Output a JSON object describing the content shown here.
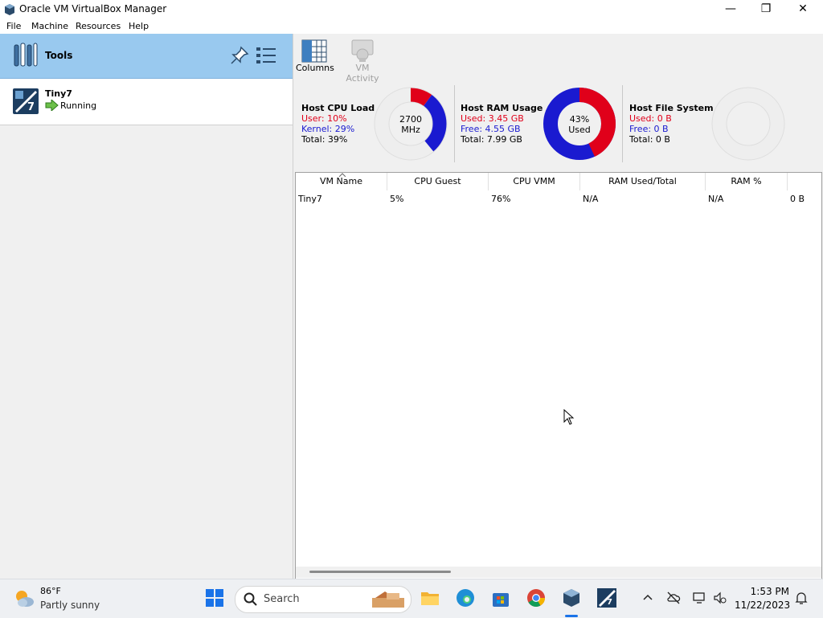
{
  "window": {
    "title": "Oracle VM VirtualBox Manager",
    "controls": {
      "minimize": "—",
      "maximize": "❐",
      "close": "✕"
    }
  },
  "menu": [
    "File",
    "Machine",
    "Resources",
    "Help"
  ],
  "sidebar": {
    "tools_label": "Tools",
    "vms": [
      {
        "name": "Tiny7",
        "state": "Running"
      }
    ]
  },
  "toolbar": {
    "columns_label": "Columns",
    "vm_activity_label": "VM Activity"
  },
  "resources": {
    "cpu": {
      "title": "Host CPU Load",
      "user": "User: 10%",
      "kernel": "Kernel: 29%",
      "total": "Total: 39%",
      "center_line1": "2700",
      "center_line2": "MHz",
      "user_pct": 10,
      "kernel_pct": 29
    },
    "ram": {
      "title": "Host RAM Usage",
      "used": "Used: 3.45 GB",
      "free": "Free: 4.55 GB",
      "total": "Total: 7.99 GB",
      "center_line1": "43%",
      "center_line2": "Used",
      "used_pct": 43
    },
    "fs": {
      "title": "Host File System",
      "used": "Used: 0 B",
      "free": "Free: 0 B",
      "total": "Total: 0 B"
    }
  },
  "table": {
    "columns": [
      "VM Name",
      "CPU Guest",
      "CPU VMM",
      "RAM Used/Total",
      "RAM %"
    ],
    "rows": [
      {
        "name": "Tiny7",
        "cpu_guest": "5%",
        "cpu_vmm": "76%",
        "ram_used_total": "N/A",
        "ram_pct": "N/A",
        "extra": "0 B"
      }
    ]
  },
  "taskbar": {
    "weather_temp": "86°F",
    "weather_desc": "Partly sunny",
    "search_placeholder": "Search",
    "time": "1:53 PM",
    "date": "11/22/2023"
  },
  "colors": {
    "selection": "#99c9ef",
    "red": "#e0001a",
    "blue": "#1a1ad0"
  }
}
